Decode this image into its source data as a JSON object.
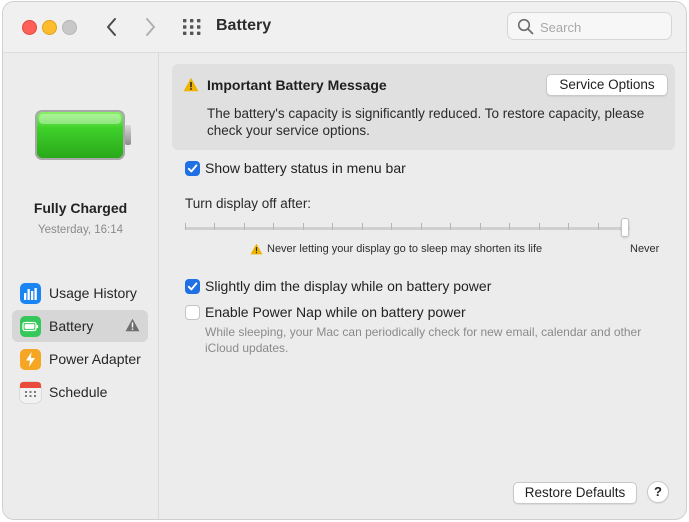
{
  "window": {
    "title": "Battery"
  },
  "search": {
    "placeholder": "Search",
    "value": ""
  },
  "sidebar": {
    "charge_status": "Fully Charged",
    "charge_time": "Yesterday, 16:14",
    "items": [
      {
        "label": "Usage History",
        "icon": "bar-chart-icon",
        "color": "#1a84f5",
        "selected": false
      },
      {
        "label": "Battery",
        "icon": "battery-icon",
        "color": "#34c759",
        "selected": true,
        "warning": true
      },
      {
        "label": "Power Adapter",
        "icon": "lightning-icon",
        "color": "#f5a623",
        "selected": false
      },
      {
        "label": "Schedule",
        "icon": "calendar-icon",
        "color": "#e94b3c",
        "selected": false
      }
    ]
  },
  "message": {
    "title": "Important Battery Message",
    "body": "The battery's capacity is significantly reduced. To restore capacity, please check your service options.",
    "button": "Service Options"
  },
  "options": {
    "show_status": {
      "label": "Show battery status in menu bar",
      "checked": true
    },
    "display_off": {
      "label": "Turn display off after:",
      "warning": "Never letting your display go to sleep may shorten its life",
      "end_label": "Never",
      "value": "Never"
    },
    "dim_display": {
      "label": "Slightly dim the display while on battery power",
      "checked": true
    },
    "power_nap": {
      "label": "Enable Power Nap while on battery power",
      "checked": false,
      "description": "While sleeping, your Mac can periodically check for new email, calendar and other iCloud updates."
    }
  },
  "footer": {
    "restore_label": "Restore Defaults",
    "help_label": "?"
  },
  "colors": {
    "accent": "#1f6fe5",
    "warning": "#f0b400",
    "battery_green": "#3ccf2c"
  }
}
